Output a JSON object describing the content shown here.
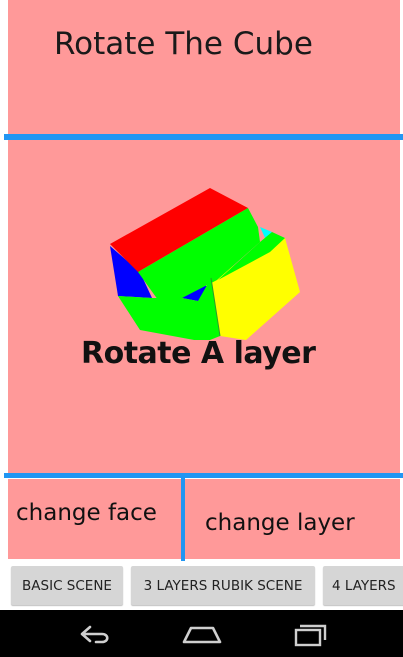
{
  "header": {
    "title": "Rotate The Cube"
  },
  "cube_area": {
    "label": "Rotate A layer"
  },
  "controls": {
    "change_face": "change face",
    "change_layer": "change layer"
  },
  "scene_buttons": [
    {
      "label": "BASIC SCENE"
    },
    {
      "label": "3 LAYERS RUBIK SCENE"
    },
    {
      "label": "4 LAYERS"
    }
  ],
  "colors": {
    "pane_background": "#ff9999",
    "divider": "#2196f3",
    "cube_red": "#ff0000",
    "cube_green": "#00ff00",
    "cube_yellow": "#ffff00",
    "cube_blue": "#0000ff",
    "cube_cyan": "#00ffff"
  },
  "nav_icons": [
    "back-icon",
    "home-icon",
    "recent-apps-icon"
  ]
}
